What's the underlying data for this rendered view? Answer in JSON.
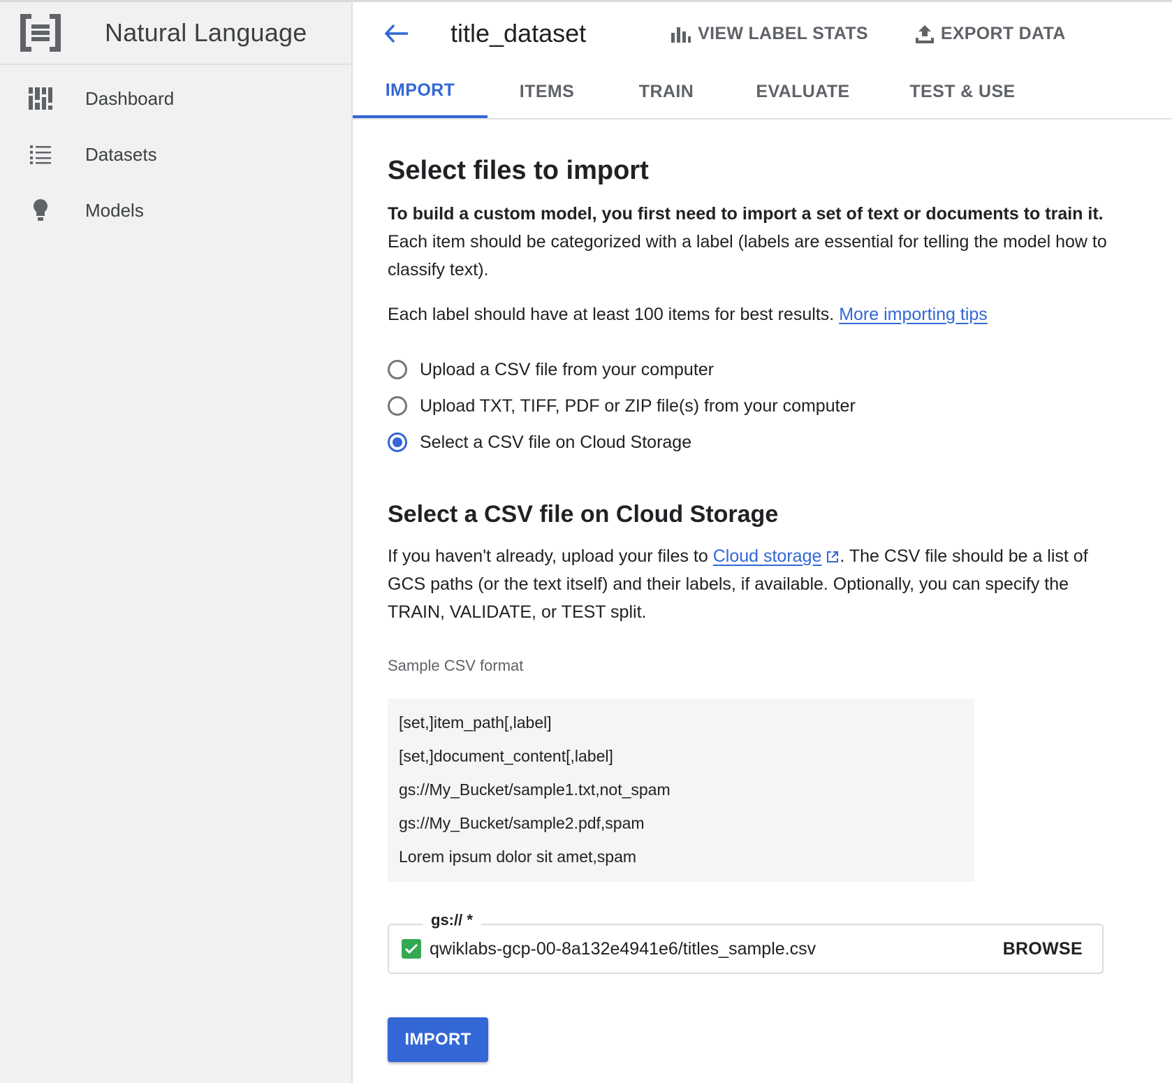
{
  "app": {
    "title": "Natural Language",
    "logo_icon": "natural-language-logo"
  },
  "sidebar": {
    "items": [
      {
        "label": "Dashboard",
        "icon": "dashboard-icon"
      },
      {
        "label": "Datasets",
        "icon": "list-icon"
      },
      {
        "label": "Models",
        "icon": "lightbulb-icon"
      }
    ]
  },
  "header": {
    "dataset_name": "title_dataset",
    "view_label_stats": "VIEW LABEL STATS",
    "export_data": "EXPORT DATA"
  },
  "tabs": [
    "IMPORT",
    "ITEMS",
    "TRAIN",
    "EVALUATE",
    "TEST & USE"
  ],
  "active_tab": "IMPORT",
  "content": {
    "title": "Select files to import",
    "intro_bold": "To build a custom model, you first need to import a set of text or documents to train it.",
    "intro_rest": "Each item should be categorized with a label (labels are essential for telling the model how to classify text).",
    "tip_text": "Each label should have at least 100 items for best results.",
    "tip_link": "More importing tips",
    "radio_options": [
      {
        "label": "Upload a CSV file from your computer",
        "checked": false
      },
      {
        "label": "Upload TXT, TIFF, PDF or ZIP file(s) from your computer",
        "checked": false
      },
      {
        "label": "Select a CSV file on Cloud Storage",
        "checked": true
      }
    ],
    "csv_section": {
      "title": "Select a CSV file on Cloud Storage",
      "desc_before": "If you haven't already, upload your files to",
      "desc_link": "Cloud storage",
      "desc_after": ". The CSV file should be a list of GCS paths (or the text itself) and their labels, if available. Optionally, you can specify the TRAIN, VALIDATE, or TEST split."
    },
    "sample_label": "Sample CSV format",
    "sample_lines": [
      "[set,]item_path[,label]",
      "[set,]document_content[,label]",
      "gs://My_Bucket/sample1.txt,not_spam",
      "gs://My_Bucket/sample2.pdf,spam",
      "Lorem ipsum dolor sit amet,spam"
    ],
    "gs_field": {
      "legend": "gs:// *",
      "value": "qwiklabs-gcp-00-8a132e4941e6/titles_sample.csv",
      "browse": "BROWSE"
    },
    "import_button": "IMPORT"
  },
  "colors": {
    "accent": "#3367d6",
    "check_green": "#34a853",
    "sidebar_bg": "#f1f1f1"
  }
}
